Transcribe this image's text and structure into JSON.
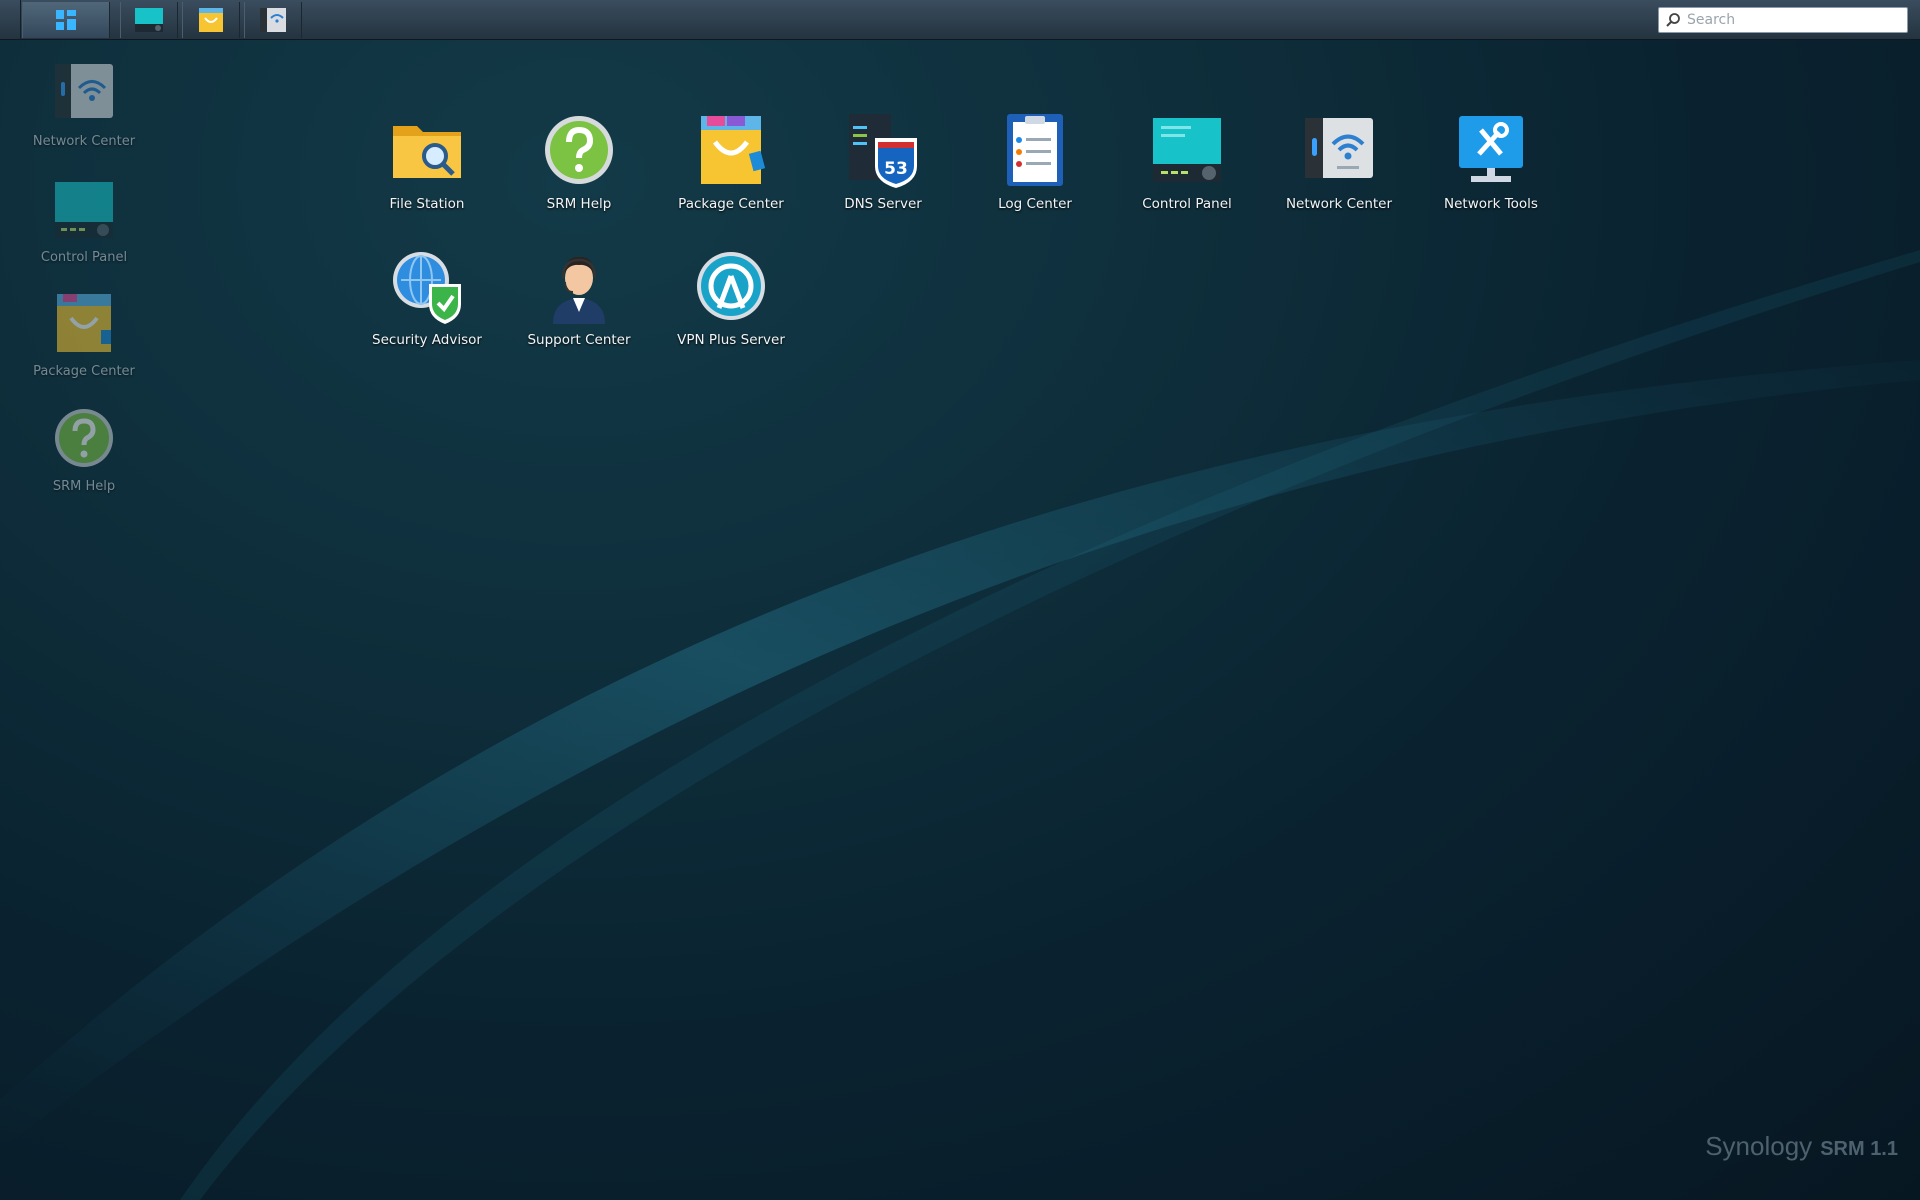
{
  "taskbar": {
    "search_placeholder": "Search",
    "buttons": [
      "main-menu-icon",
      "control-panel-icon",
      "package-center-icon",
      "network-center-icon"
    ]
  },
  "desktop_shortcuts": [
    {
      "label": "Network Center",
      "icon": "network-center-icon"
    },
    {
      "label": "Control Panel",
      "icon": "control-panel-icon"
    },
    {
      "label": "Package Center",
      "icon": "package-center-icon"
    },
    {
      "label": "SRM Help",
      "icon": "help-icon"
    }
  ],
  "main_menu": {
    "apps": [
      {
        "label": "File Station",
        "icon": "folder-search-icon"
      },
      {
        "label": "SRM Help",
        "icon": "help-icon"
      },
      {
        "label": "Package Center",
        "icon": "package-center-icon"
      },
      {
        "label": "DNS Server",
        "icon": "dns-53-icon"
      },
      {
        "label": "Log Center",
        "icon": "clipboard-log-icon"
      },
      {
        "label": "Control Panel",
        "icon": "control-panel-icon"
      },
      {
        "label": "Network Center",
        "icon": "network-center-icon"
      },
      {
        "label": "Network Tools",
        "icon": "network-tools-icon"
      },
      {
        "label": "Security Advisor",
        "icon": "globe-shield-icon"
      },
      {
        "label": "Support Center",
        "icon": "support-agent-icon"
      },
      {
        "label": "VPN Plus Server",
        "icon": "vpn-icon"
      }
    ]
  },
  "branding": {
    "name": "Synology",
    "product": "SRM 1.1"
  },
  "colors": {
    "accent": "#1aa4e8",
    "desktop": "#0e2d3a"
  }
}
